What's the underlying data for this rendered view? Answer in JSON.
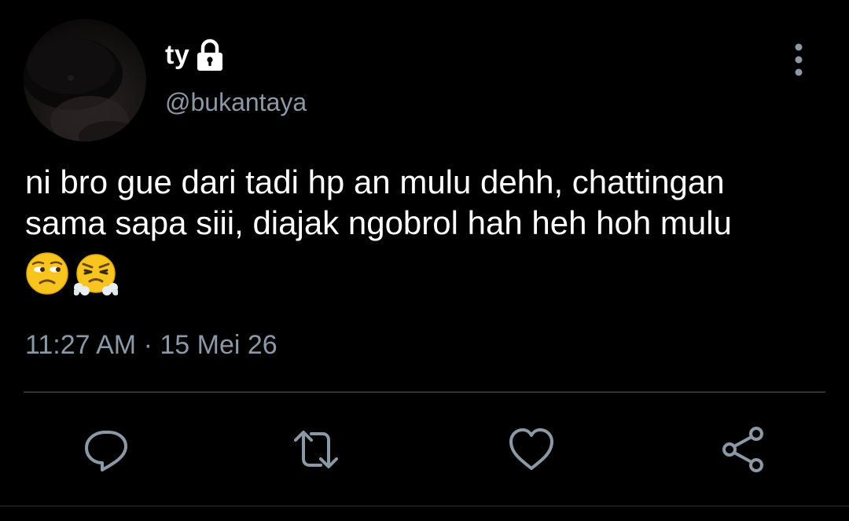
{
  "tweet": {
    "author": {
      "display_name": "ty",
      "handle": "@bukantaya",
      "protected_icon": "lock-icon",
      "avatar_icon": "avatar"
    },
    "text_lines": [
      "ni bro gue dari tadi hp an mulu dehh, chattingan",
      "sama sapa siii, diajak ngobrol hah heh hoh mulu"
    ],
    "emojis": [
      "unamused-face-emoji",
      "face-with-steam-from-nose-emoji"
    ],
    "time": "11:27 AM",
    "separator": "·",
    "date": "15 Mei 26"
  },
  "actions": {
    "reply_icon": "reply-icon",
    "retweet_icon": "retweet-icon",
    "like_icon": "heart-icon",
    "share_icon": "share-icon",
    "more_icon": "more-vertical-icon"
  },
  "colors": {
    "background": "#000000",
    "primary_text": "#ffffff",
    "secondary_text": "#8b98a5",
    "divider": "#2f3336"
  }
}
